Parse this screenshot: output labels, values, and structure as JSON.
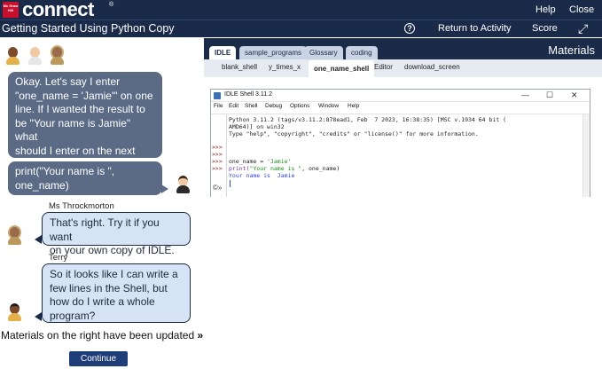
{
  "app": {
    "brand_badge": "Mc Graw Hill",
    "brand_name": "connect",
    "brand_mark": "®",
    "help_label": "Help",
    "close_label": "Close"
  },
  "activity": {
    "title": "Getting Started Using Python Copy",
    "help_icon_glyph": "?",
    "return_label": "Return to Activity",
    "score_label": "Score",
    "expand_icon": "expand-icon"
  },
  "chat": {
    "messages": [
      {
        "speaker": "",
        "role": "student",
        "text_lines": [
          "Okay. Let's say I enter",
          "\"one_name = 'Jamie'\" on one",
          "line. If I wanted the result to",
          "be \"Your name is Jamie\" what",
          "should I enter on the next",
          "line?"
        ]
      },
      {
        "speaker": "",
        "role": "student",
        "text_lines": [
          "print(\"Your name is \",",
          "one_name)"
        ]
      },
      {
        "speaker": "Ms Throckmorton",
        "role": "tutor",
        "text_lines": [
          "That's right. Try it if you want",
          "on your own copy of IDLE."
        ]
      },
      {
        "speaker": "Terry",
        "role": "tutor",
        "text_lines": [
          "So it looks like I can write a",
          "few lines in the Shell, but",
          "how do I write a whole",
          "program?"
        ]
      }
    ],
    "updated_text": "Materials on the right have been updated",
    "updated_chevron": "»",
    "continue_label": "Continue"
  },
  "materials": {
    "title": "Materials",
    "tabs": [
      {
        "label": "IDLE",
        "active": true
      },
      {
        "label": "sample_programs",
        "active": false
      },
      {
        "label": "Glossary",
        "active": false
      },
      {
        "label": "coding",
        "active": false
      }
    ],
    "subtabs": [
      {
        "label": "blank_shell",
        "active": false
      },
      {
        "label": "y_times_x",
        "active": false
      },
      {
        "label": "one_name_shell",
        "active": true
      },
      {
        "label": "Editor",
        "active": false
      },
      {
        "label": "download_screen",
        "active": false
      }
    ]
  },
  "idle": {
    "window_title": "IDLE Shell 3.11.2",
    "minimize": "—",
    "maximize": "☐",
    "close": "✕",
    "menu": [
      "File",
      "Edit",
      "Shell",
      "Debug",
      "Options",
      "Window",
      "Help"
    ],
    "prompts": [
      ">>>",
      ">>>",
      ">>>",
      ">>>"
    ],
    "lines": {
      "banner1": "Python 3.11.2 (tags/v3.11.2:878ead1, Feb  7 2023, 16:38:35) [MSC v.1934 64 bit (",
      "banner2": "AMD64)] on win32",
      "banner3": "Type \"help\", \"copyright\", \"credits\" or \"license()\" for more information.",
      "assign_var": "one_name = ",
      "assign_str": "'Jamie'",
      "print_kw": "print(",
      "print_str": "\"Your name is \"",
      "print_rest": ", one_name)",
      "result": "Your name is  Jamie"
    },
    "debug_glyph": "©»"
  },
  "colors": {
    "navy": "#1a2b4a",
    "bubble_student": "#5b6b86",
    "bubble_tutor": "#d5e3f5",
    "continue": "#1f3d78"
  }
}
